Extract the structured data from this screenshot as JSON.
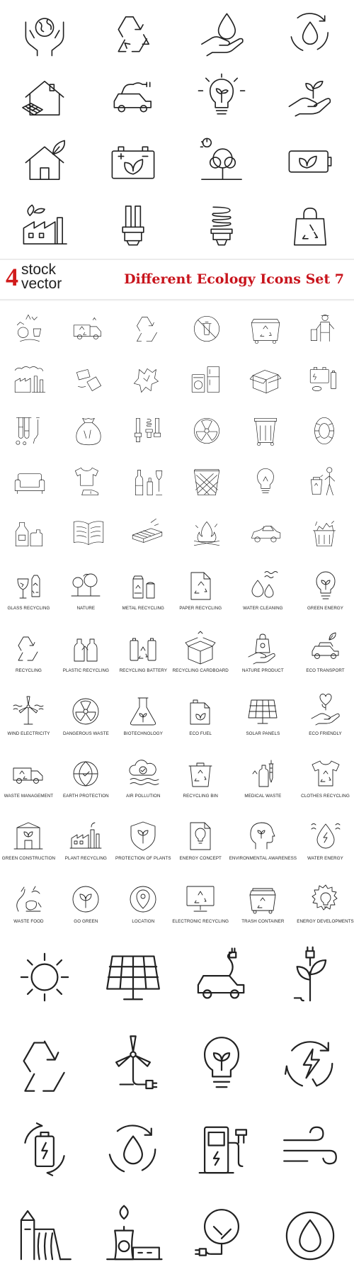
{
  "banner": {
    "brand_digit": "4",
    "brand_line1": "stock",
    "brand_line2": "vector",
    "title": "Different Ecology Icons Set 7",
    "accent_color": "#c8141c"
  },
  "set1_icons": [
    "globe-in-hands",
    "recycle",
    "water-drop-hand",
    "water-cycle",
    "solar-house",
    "electric-car",
    "light-bulb-plant",
    "plant-in-hand",
    "eco-house",
    "eco-battery",
    "tree-sun",
    "battery-leaf",
    "factory-plant",
    "cfl-lamp",
    "spiral-lamp",
    "recycling-bag"
  ],
  "set2_icons": [
    "waste-sorting",
    "garbage-truck",
    "recycle-arrows",
    "no-trash-sign",
    "garbage-container",
    "waste-worker",
    "factory-pollution",
    "crushed-cans",
    "paper-scrap",
    "household-appliances",
    "cardboard-boxes",
    "batteries",
    "test-tubes",
    "trash-bag",
    "cfl-lamps",
    "radiation",
    "wheelie-bin",
    "tire",
    "old-sofa",
    "clothes-shoes",
    "glass-bottles",
    "wicker-basket",
    "light-bulb",
    "person-throwing-trash",
    "plastic-containers",
    "open-book",
    "wooden-pallet",
    "campfire",
    "old-car",
    "overflowing-trash"
  ],
  "set3_items": [
    {
      "icon": "broken-glass",
      "label": "Glass Recycling"
    },
    {
      "icon": "trees",
      "label": "Nature"
    },
    {
      "icon": "metal-can",
      "label": "Metal Recycling"
    },
    {
      "icon": "paper-document",
      "label": "Paper Recycling"
    },
    {
      "icon": "water-drops",
      "label": "Water Cleaning"
    },
    {
      "icon": "bulb-leaf",
      "label": "Green Energy"
    },
    {
      "icon": "recycle-arrows",
      "label": "Recycling"
    },
    {
      "icon": "plastic-bottles",
      "label": "Plastic Recycling"
    },
    {
      "icon": "batteries-recycle",
      "label": "Recycling Battery"
    },
    {
      "icon": "cardboard-box",
      "label": "Recycling Cardboard"
    },
    {
      "icon": "bag-in-hand",
      "label": "Nature Product"
    },
    {
      "icon": "eco-car",
      "label": "Eco Transport"
    },
    {
      "icon": "wind-turbine",
      "label": "Wind Electricity"
    },
    {
      "icon": "radiation-sign",
      "label": "Dangerous Waste"
    },
    {
      "icon": "lab-flask",
      "label": "Biotechnology"
    },
    {
      "icon": "fuel-canister",
      "label": "Eco Fuel"
    },
    {
      "icon": "solar-panel",
      "label": "Solar Panels"
    },
    {
      "icon": "heart-plant-hand",
      "label": "Eco Friendly"
    },
    {
      "icon": "waste-truck",
      "label": "Waste Management"
    },
    {
      "icon": "globe-shield",
      "label": "Earth Protection"
    },
    {
      "icon": "cloud-smog",
      "label": "Air Pollution"
    },
    {
      "icon": "recycling-bin",
      "label": "Recycling Bin"
    },
    {
      "icon": "syringe-bottle",
      "label": "Medical Waste"
    },
    {
      "icon": "t-shirt",
      "label": "Clothes Recycling"
    },
    {
      "icon": "eco-building",
      "label": "Green Construction"
    },
    {
      "icon": "factory",
      "label": "Plant Recycling"
    },
    {
      "icon": "shield-leaf",
      "label": "Protection of Plants"
    },
    {
      "icon": "document-bulb",
      "label": "Energy Concept"
    },
    {
      "icon": "head-leaf",
      "label": "Environmental Awareness"
    },
    {
      "icon": "water-drop-bolt",
      "label": "Water Energy"
    },
    {
      "icon": "food-waste",
      "label": "Waste Food"
    },
    {
      "icon": "leaf-circle",
      "label": "Go Green"
    },
    {
      "icon": "location-pin",
      "label": "Location"
    },
    {
      "icon": "computer-recycle",
      "label": "Electronic Recycling"
    },
    {
      "icon": "trash-container",
      "label": "Trash Container"
    },
    {
      "icon": "gear-bulb",
      "label": "Energy Developments"
    }
  ],
  "set4_icons": [
    "sun",
    "solar-panel",
    "electric-car-plug",
    "plant-plug",
    "recycle-triangle",
    "wind-turbine-plug",
    "bulb-leaf",
    "energy-cycle",
    "battery-cycle",
    "water-cycle",
    "charging-station",
    "wind",
    "hydro-dam",
    "nuclear-plant",
    "tree-plug",
    "water-drop-circle"
  ]
}
